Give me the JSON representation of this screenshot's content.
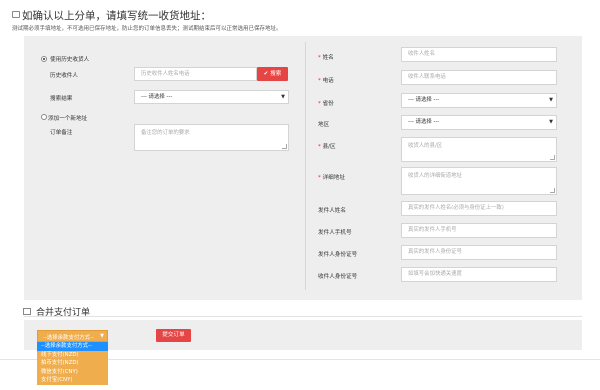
{
  "header": {
    "title": "如确认以上分单，请填写统一收货地址：",
    "subtitle": "测试期必须手填地址，不可选用已保存地址，防止您的订单信息丢失；测试期结束后可以正常选用已保存地址。"
  },
  "left": {
    "use_history_label": "使用历史收货人",
    "history_receiver_label": "历史收件人",
    "history_search_placeholder": "历史收件人姓名电话",
    "search_button": "搜索",
    "search_result_label": "搜索结果",
    "search_result_value": "--- 请选择 ---",
    "add_new_label": "添加一个新地址",
    "order_note_label": "订单备注",
    "order_note_placeholder": "备注您的订单的要求"
  },
  "right": {
    "name_label": "姓名",
    "name_placeholder": "收件人姓名",
    "phone_label": "电话",
    "phone_placeholder": "收件人联系电话",
    "province_label": "省份",
    "province_value": "--- 请选择 ---",
    "district_label": "地区",
    "district_value": "--- 请选择 ---",
    "county_label": "县/区",
    "county_placeholder": "收货人的县/区",
    "address_label": "详细地址",
    "address_placeholder": "收货人的详细街道地址",
    "sender_name_label": "发件人姓名",
    "sender_name_placeholder": "真实的发件人姓名(必须与身份证上一致)",
    "sender_phone_label": "发件人手机号",
    "sender_phone_placeholder": "真实的发件人手机号",
    "sender_id_label": "发件人身份证号",
    "sender_id_placeholder": "真实的发件人身份证号",
    "receiver_id_label": "收件人身份证号",
    "receiver_id_placeholder": "如填写会加快通关速度"
  },
  "payment": {
    "section_title": "合并支付订单",
    "select_value": "--选择余款支付方式--",
    "options": [
      "--选择余款支付方式--",
      "线下支付(NZD)",
      "拍币支付(NZD)",
      "微信支付(CNY)",
      "支付宝(CNY)"
    ],
    "submit_button": "提交订单"
  },
  "colors": {
    "accent_red": "#e64545",
    "select_orange": "#f0ad4e",
    "highlight_blue": "#1e90ff",
    "panel_gray": "#eeeeee"
  }
}
